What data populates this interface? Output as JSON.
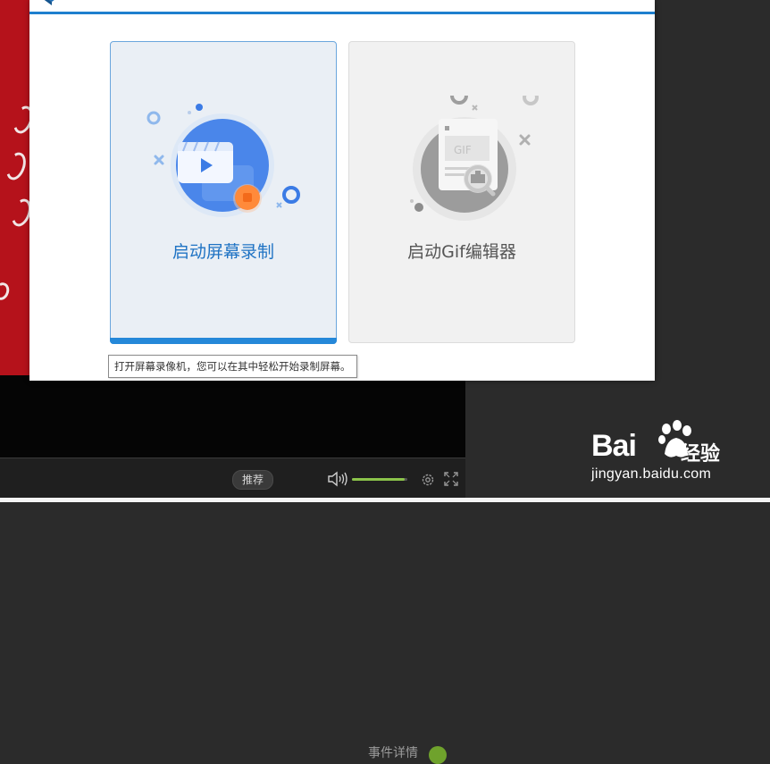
{
  "dialog": {
    "cards": [
      {
        "label": "启动屏幕录制",
        "state": "selected"
      },
      {
        "label": "启动Gif编辑器",
        "state": "default"
      }
    ],
    "tooltip": "打开屏幕录像机，您可以在其中轻松开始录制屏幕。"
  },
  "player": {
    "recommend_label": "推荐",
    "volume_level": 0.95,
    "obscured_label": "事件详情"
  },
  "watermark": {
    "brand": "Bai",
    "brand_cn": "经验",
    "url": "jingyan.baidu.com"
  },
  "colors": {
    "accent": "#2588d9",
    "volume": "#8bc34a",
    "video_red": "#b5121b"
  }
}
